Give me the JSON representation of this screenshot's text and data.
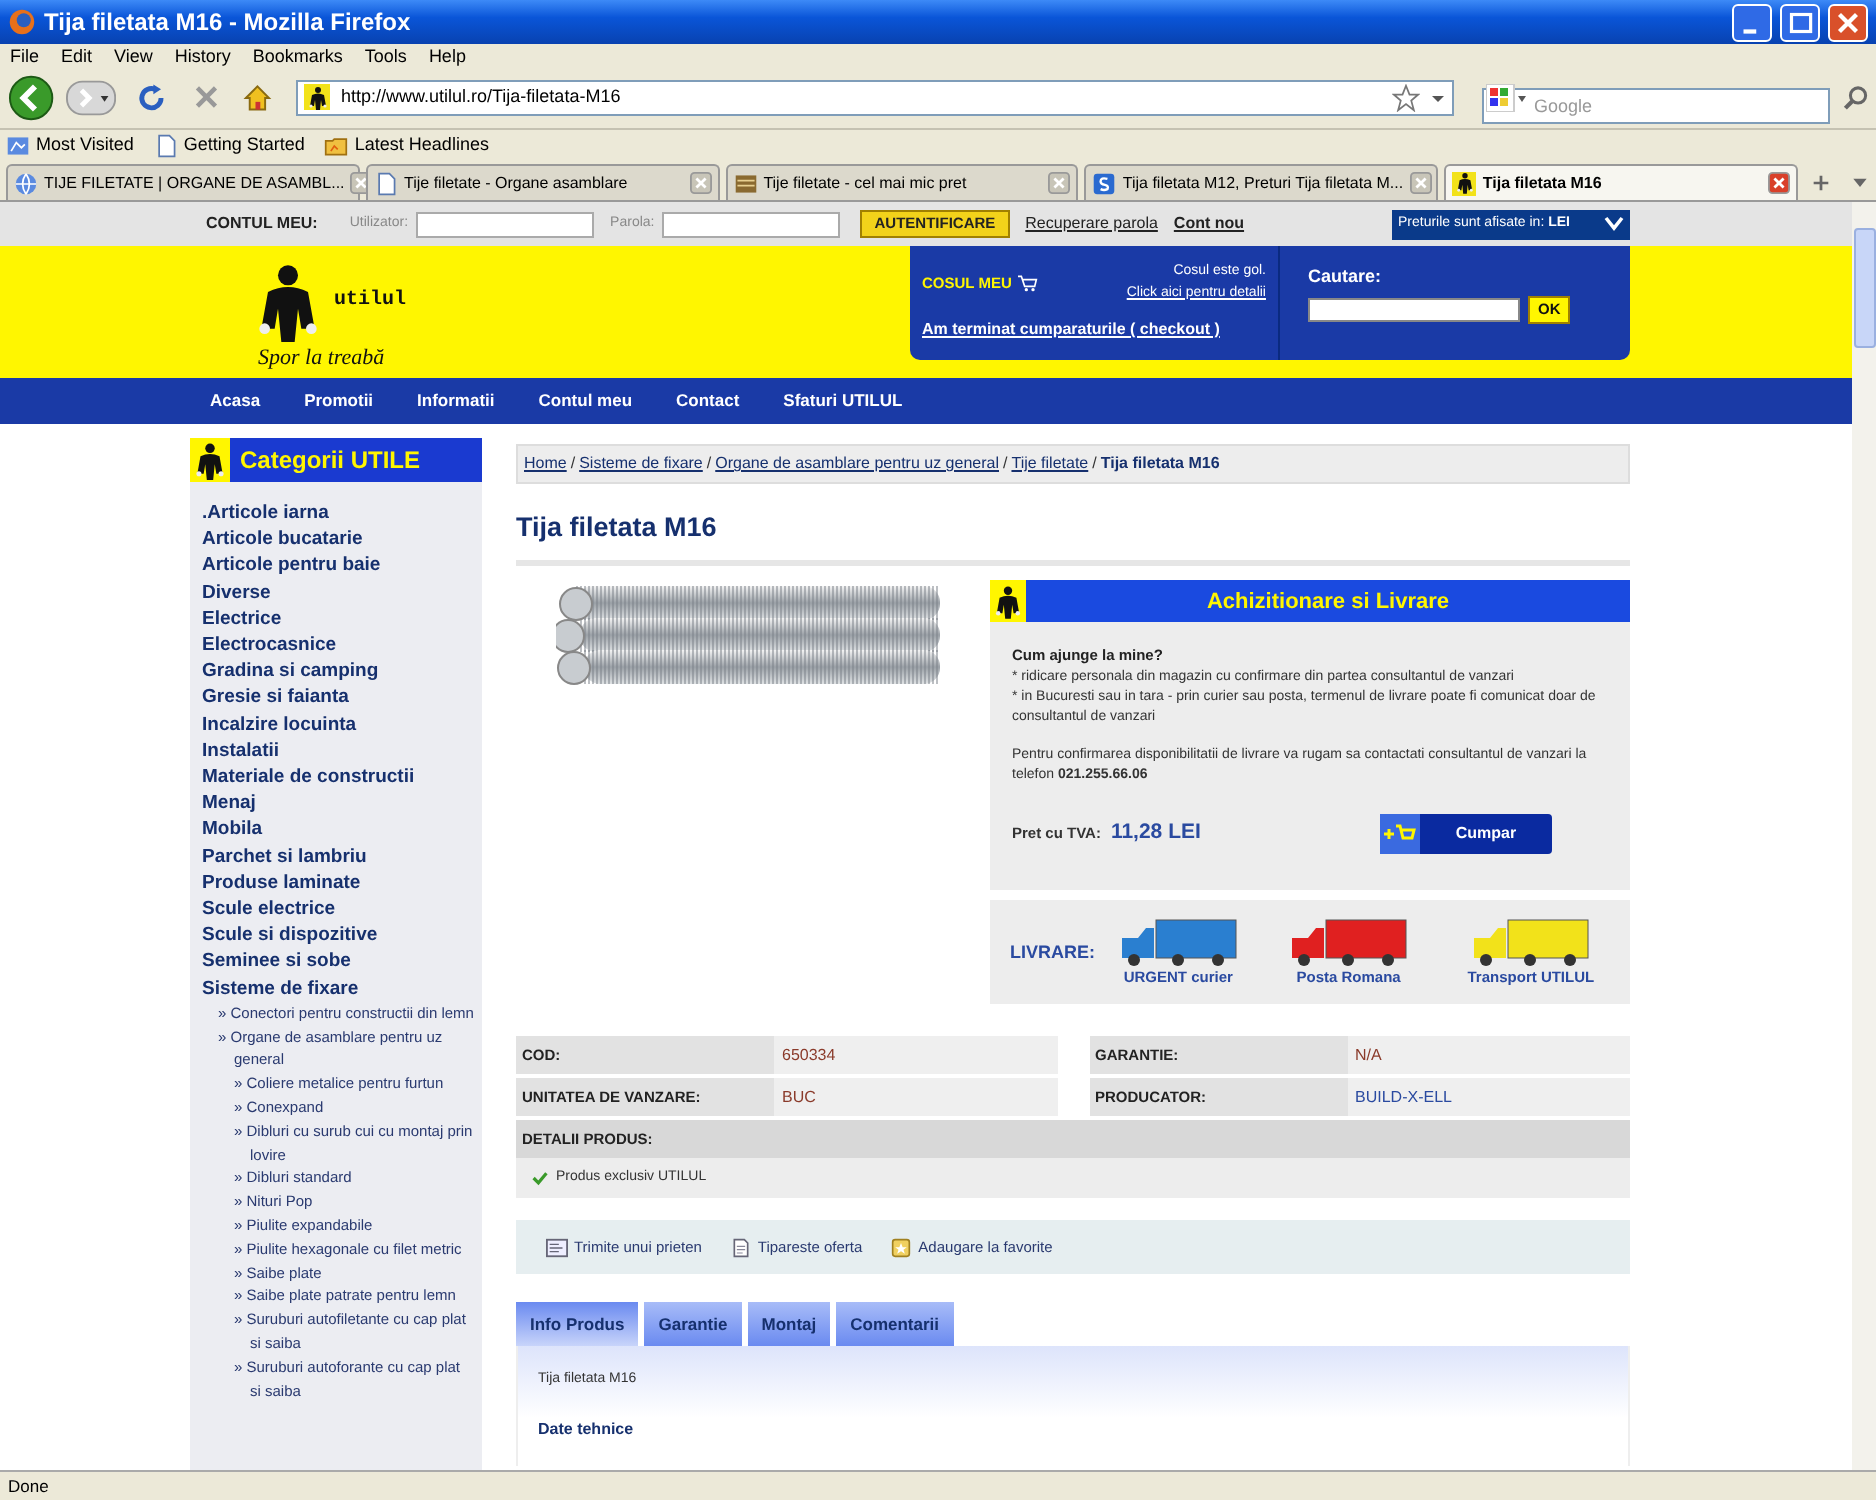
{
  "window": {
    "title": "Tija filetata M16 - Mozilla Firefox"
  },
  "menu": [
    "File",
    "Edit",
    "View",
    "History",
    "Bookmarks",
    "Tools",
    "Help"
  ],
  "address_bar": {
    "url": "http://www.utilul.ro/Tija-filetata-M16"
  },
  "search_bar": {
    "placeholder": "Google"
  },
  "bookmarks": [
    "Most Visited",
    "Getting Started",
    "Latest Headlines"
  ],
  "tabs": [
    {
      "label": "TIJE FILETATE | ORGANE DE ASAMBL...",
      "selected": false
    },
    {
      "label": "Tije filetate - Organe asamblare",
      "selected": false
    },
    {
      "label": "Tije filetate - cel mai mic pret",
      "selected": false
    },
    {
      "label": "Tija filetata M12, Preturi Tija filetata M...",
      "selected": false
    },
    {
      "label": "Tija filetata M16",
      "selected": true
    }
  ],
  "account_bar": {
    "label": "CONTUL MEU:",
    "user_label": "Utilizator:",
    "password_label": "Parola:",
    "login_button": "AUTENTIFICARE",
    "links": [
      "Recuperare parola",
      "Cont nou"
    ],
    "currency": "Preturile sunt afisate in: **LEI**"
  },
  "logo": {
    "name": "utilul",
    "slogan": "Spor la treabă"
  },
  "cart": {
    "title": "COSUL MEU",
    "status": "Cosul este gol.",
    "details_link": "Click aici pentru detalii",
    "checkout_link": "Am terminat cumparaturile ( checkout )"
  },
  "site_search": {
    "label": "Cautare:",
    "button": "OK"
  },
  "nav": [
    "Acasa",
    "Promotii",
    "Informatii",
    "Contul meu",
    "Contact",
    "Sfaturi UTILUL"
  ],
  "sidebar": {
    "title": "Categorii UTILE",
    "items": [
      {
        "label": ".Articole iarna"
      },
      {
        "label": "Articole bucatarie"
      },
      {
        "label": "Articole pentru baie"
      },
      {
        "label": "Diverse"
      },
      {
        "label": "Electrice"
      },
      {
        "label": "Electrocasnice"
      },
      {
        "label": "Gradina si camping"
      },
      {
        "label": "Gresie si faianta"
      },
      {
        "label": "Incalzire locuinta"
      },
      {
        "label": "Instalatii"
      },
      {
        "label": "Materiale de constructii"
      },
      {
        "label": "Menaj"
      },
      {
        "label": "Mobila"
      },
      {
        "label": "Parchet si lambriu"
      },
      {
        "label": "Produse laminate"
      },
      {
        "label": "Scule electrice"
      },
      {
        "label": "Scule si dispozitive"
      },
      {
        "label": "Seminee si sobe"
      },
      {
        "label": "Sisteme de fixare",
        "children": [
          {
            "label": "» Conectori pentru constructii din lemn"
          },
          {
            "label": "» Organe de asamblare pentru uz general",
            "children": [
              {
                "label": "» Coliere metalice pentru furtun"
              },
              {
                "label": "» Conexpand"
              },
              {
                "label": "» Dibluri cu surub cui cu montaj prin lovire"
              },
              {
                "label": "» Dibluri standard"
              },
              {
                "label": "» Nituri Pop"
              },
              {
                "label": "» Piulite expandabile"
              },
              {
                "label": "» Piulite hexagonale cu filet metric"
              },
              {
                "label": "» Saibe plate"
              },
              {
                "label": "» Saibe plate patrate pentru lemn"
              },
              {
                "label": "» Suruburi autofiletante cu cap plat si saiba"
              },
              {
                "label": "» Suruburi autoforante cu cap plat si saiba"
              }
            ]
          }
        ]
      }
    ]
  },
  "breadcrumb": {
    "separator": "/",
    "items": [
      "Home",
      "Sisteme de fixare",
      "Organe de asamblare pentru uz general",
      "Tije filetate",
      "Tija filetata M16"
    ]
  },
  "product": {
    "title": "Tija filetata M16"
  },
  "purchase": {
    "title": "Achizitionare si Livrare",
    "question": "Cum ajunge la mine?",
    "lines": [
      "* ridicare personala din magazin cu confirmare din partea consultantul de vanzari",
      "* in Bucuresti sau in tara - prin curier sau posta, termenul de livrare poate fi comunicat doar de consultantul de vanzari"
    ],
    "contact": "Pentru confirmarea disponibilitatii de livrare va rugam sa contactati consultantul de vanzari la telefon **021.255.66.06**",
    "price_label": "Pret cu TVA:",
    "price": "11,28 LEI",
    "buy_button": "Cumpar"
  },
  "delivery": {
    "label": "LIVRARE:",
    "couriers": [
      {
        "name": "URGENT curier",
        "color": "#2a7fd0"
      },
      {
        "name": "Posta Romana",
        "color": "#e02020"
      },
      {
        "name": "Transport UTILUL",
        "color": "#f2e21a"
      }
    ]
  },
  "specs": [
    {
      "label": "COD:",
      "value": "650334",
      "kind": "text"
    },
    {
      "label": "GARANTIE:",
      "value": "N/A",
      "kind": "text"
    },
    {
      "label": "UNITATEA DE VANZARE:",
      "value": "BUC",
      "kind": "text"
    },
    {
      "label": "PRODUCATOR:",
      "value": "BUILD-X-ELL",
      "kind": "link"
    }
  ],
  "details": {
    "title": "DETALII PRODUS:",
    "items": [
      "Produs exclusiv UTILUL"
    ]
  },
  "actions": [
    {
      "label": "Trimite unui prieten",
      "kind": "mail"
    },
    {
      "label": "Tipareste oferta",
      "kind": "print"
    },
    {
      "label": "Adaugare la favorite",
      "kind": "favorite"
    }
  ],
  "product_tabs": [
    {
      "label": "Info Produs",
      "selected": true
    },
    {
      "label": "Garantie",
      "selected": false
    },
    {
      "label": "Montaj",
      "selected": false
    },
    {
      "label": "Comentarii",
      "selected": false
    }
  ],
  "tab_content": {
    "text": "Tija filetata M16",
    "heading": "Date tehnice"
  },
  "status_bar": {
    "text": "Done"
  }
}
